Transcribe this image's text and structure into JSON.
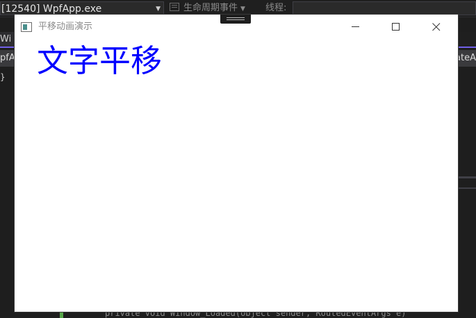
{
  "ide": {
    "process_combo_text": "[12540] WpfApp.exe",
    "lifecycle_label": "生命周期事件",
    "thread_label": "线程:",
    "tab_label": "Wi",
    "nav_left_text": "pfA",
    "nav_right_text": "ateA",
    "gutter_mark": "}",
    "code_snippet": "private void Window_Loaded(object sender, RoutedEventArgs e)"
  },
  "window": {
    "title": "平移动画演示",
    "animated_text": "文字平移",
    "text_color": "#0000ff",
    "background": "#ffffff",
    "icons": {
      "app": "window-app-icon",
      "minimize": "minimize-icon",
      "maximize": "maximize-icon",
      "close": "close-icon",
      "drag": "drag-handle-icon"
    }
  },
  "colors": {
    "ide_background": "#1e1e1e",
    "accent_purple": "#7160e8"
  }
}
